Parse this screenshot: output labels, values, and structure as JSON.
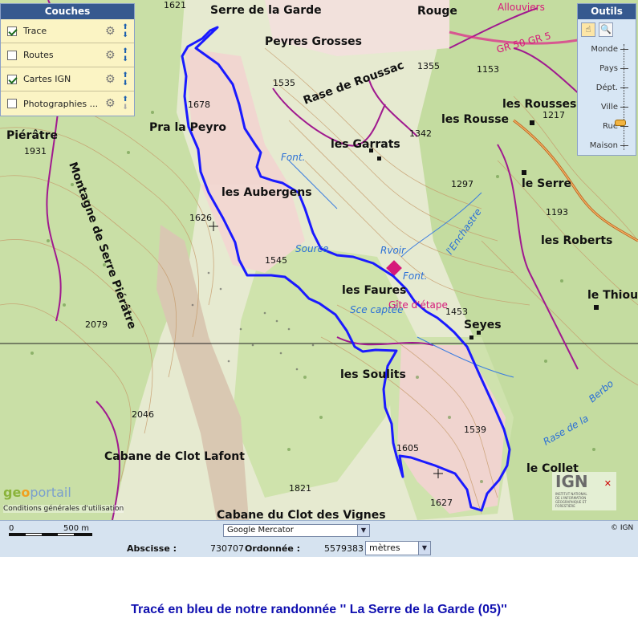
{
  "layers_panel": {
    "title": "Couches",
    "items": [
      {
        "label": "Trace",
        "checked": true
      },
      {
        "label": "Routes",
        "checked": false
      },
      {
        "label": "Cartes IGN",
        "checked": true
      },
      {
        "label": "Photographies ...",
        "checked": false
      }
    ]
  },
  "tools_panel": {
    "title": "Outils",
    "tools": [
      "pan-hand-icon",
      "zoom-magnifier-icon"
    ],
    "zoom_levels": [
      "Monde",
      "Pays",
      "Dépt.",
      "Ville",
      "Rue",
      "Maison"
    ],
    "selected_zoom": "Rue"
  },
  "map": {
    "labels": {
      "serre_de_la_garde": "Serre de la Garde",
      "rouge": "Rouge",
      "allouviers": "Allouviers",
      "peyres_grosses": "Peyres Grosses",
      "alt_1621": "1621",
      "alt_1355": "1355",
      "alt_1153": "1153",
      "alt_1535": "1535",
      "rase_de_roussac": "Rase de Roussac",
      "les_rousses": "les Rousses",
      "alt_1217": "1217",
      "alt_1678": "1678",
      "pra_la_peyro": "Pra la Peyro",
      "les_rousse": "les Rousse",
      "alt_1342": "1342",
      "les_garrats": "les Garrats",
      "pierratre": "Piérâtre",
      "alt_1931": "1931",
      "font": "Font.",
      "les_aubergens": "les Aubergens",
      "alt_1297": "1297",
      "le_serre": "le Serre",
      "alt_1626": "1626",
      "alt_1193": "1193",
      "l_enchastre": "l'Enchastre",
      "les_roberts": "les Roberts",
      "source": "Source",
      "rvoir": "Rvoir",
      "alt_1545": "1545",
      "les_faures": "les Faures",
      "font2": "Font.",
      "le_thiour": "le Thiour",
      "montagne": "Montagne de Serre Piérâtre",
      "sce_captee": "Sce captée",
      "gite": "Gîte d'étape",
      "alt_1453": "1453",
      "seyes": "Seyes",
      "alt_2079": "2079",
      "les_soulits": "les Soulits",
      "alt_2046": "2046",
      "alt_1539": "1539",
      "rase_de_la": "Rase de la",
      "alt_1605": "1605",
      "cabane_clot_lafont": "Cabane de Clot Lafont",
      "le_collet": "le Collet",
      "alt_1821": "1821",
      "alt_1627": "1627",
      "cabane_clot_vignes": "Cabane du Clot des Vignes",
      "gr50": "GR 50 GR 5",
      "berbo": "Berbo"
    },
    "trace_color": "#1a1aff",
    "geoportail_logo": "geoportail",
    "conditions": "Conditions générales d'utilisation",
    "ign_logo": "IGN",
    "ign_sub": "INSTITUT NATIONAL DE L'INFORMATION GÉOGRAPHIQUE ET FORESTIÈRE"
  },
  "statusbar": {
    "scale_left": "0",
    "scale_right": "500 m",
    "projection": "Google Mercator",
    "copyright": "© IGN",
    "abscisse_label": "Abscisse :",
    "abscisse_value": "730707",
    "ordonnee_label": "Ordonnée :",
    "ordonnee_value": "5579383",
    "unit": "mètres"
  },
  "caption": "Tracé en bleu de notre randonnée '' La Serre de la Garde (05)''"
}
